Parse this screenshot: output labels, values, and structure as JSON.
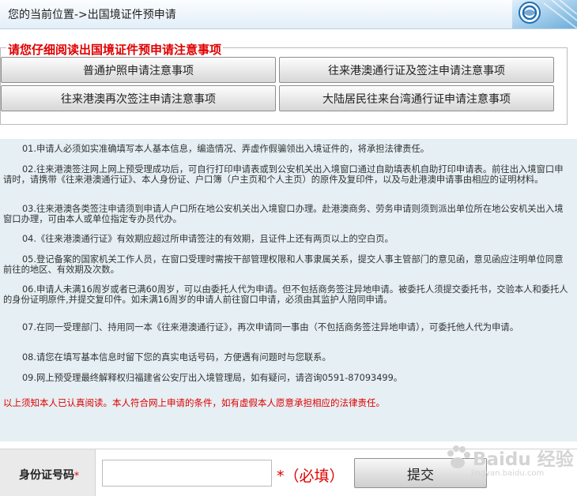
{
  "breadcrumb": "您的当前位置->出国境证件预申请",
  "notice": {
    "title": "请您仔细阅读出国境证件预申请注意事项",
    "buttons": [
      "普通护照申请注意事项",
      "往来港澳通行证及签注申请注意事项",
      "往来港澳再次签注申请注意事项",
      "大陆居民往来台湾通行证申请注意事项"
    ]
  },
  "rules": [
    "01.申请人必须如实准确填写本人基本信息，编造情况、弄虚作假骗领出入境证件的，将承担法律责任。",
    "02.往来港澳签注网上网上预受理成功后，可自行打印申请表或到公安机关出入境窗口通过自助填表机自助打印申请表。前往出入境窗口申请时，请携带《往来港澳通行证》、本人身份证、户口簿（户主页和个人主页）的原件及复印件，以及与赴港澳申请事由相应的证明材料。",
    "03.往来港澳各类签注申请须到申请人户口所在地公安机关出入境窗口办理。赴港澳商务、劳务申请则须到派出单位所在地公安机关出入境窗口办理，可由本人或单位指定专办员代办。",
    "04.《往来港澳通行证》有效期应超过所申请签注的有效期，且证件上还有两页以上的空白页。",
    "05.登记备案的国家机关工作人员，在窗口受理时需按干部管理权限和人事隶属关系，提交人事主管部门的意见函，意见函应注明单位同意前往的地区、有效期及次数。",
    "06.申请人未满16周岁或者已满60周岁，可以由委托人代为申请。但不包括商务签注异地申请。被委托人须提交委托书，交验本人和委托人的身份证明原件,并提交复印件。如未满16周岁的申请人前往窗口申请，必须由其监护人陪同申请。",
    "07.在同一受理部门、持用同一本《往来港澳通行证》，再次申请同一事由（不包括商务签注异地申请），可委托他人代为申请。",
    "08.请您在填写基本信息时留下您的真实电话号码，方便遇有问题时与您联系。",
    "09.网上预受理最终解释权归福建省公安厅出入境管理局，如有疑问，请咨询0591-87093499。"
  ],
  "warning": "以上须知本人已认真阅读。本人符合网上申请的条件，如有虚假本人愿意承担相应的法律责任。",
  "form": {
    "id_label": "身份证号码",
    "required_star": "*",
    "id_value": "",
    "required_text": "*（必填）",
    "submit_label": "提交"
  },
  "watermark": {
    "text": "Baidu 经验",
    "url": "jingyan.baidu.com"
  },
  "colors": {
    "alert_red": "#e00000",
    "rules_bg": "#e5eff4",
    "header_bg": "#e2eef8"
  }
}
